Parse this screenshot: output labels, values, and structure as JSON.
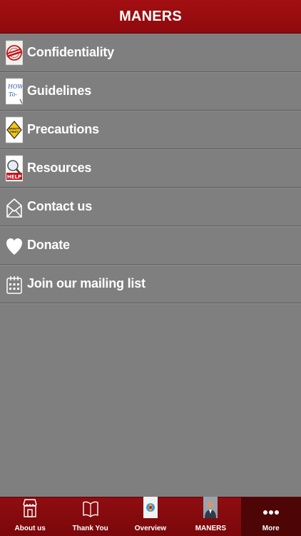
{
  "header": {
    "title": "MANERS"
  },
  "menu": {
    "items": [
      {
        "label": "Confidentiality",
        "icon": "confidential-stamp-icon"
      },
      {
        "label": "Guidelines",
        "icon": "how-to-note-icon"
      },
      {
        "label": "Precautions",
        "icon": "safety-first-sign-icon"
      },
      {
        "label": "Resources",
        "icon": "help-magnifier-icon"
      },
      {
        "label": "Contact us",
        "icon": "envelope-icon"
      },
      {
        "label": "Donate",
        "icon": "heart-icon"
      },
      {
        "label": "Join our mailing list",
        "icon": "calendar-notepad-icon"
      }
    ]
  },
  "tabbar": {
    "tabs": [
      {
        "label": "About us",
        "icon": "storefront-icon",
        "active": false
      },
      {
        "label": "Thank You",
        "icon": "open-book-icon",
        "active": false
      },
      {
        "label": "Overview",
        "icon": "overview-photo-icon",
        "active": false
      },
      {
        "label": "MANERS",
        "icon": "person-photo-icon",
        "active": false
      },
      {
        "label": "More",
        "icon": "more-dots-icon",
        "active": true
      }
    ]
  },
  "colors": {
    "header_red": "#a30f12",
    "tabbar_red": "#8f0d10",
    "active_tab": "#4e0506",
    "list_background": "#7f7f7f"
  }
}
